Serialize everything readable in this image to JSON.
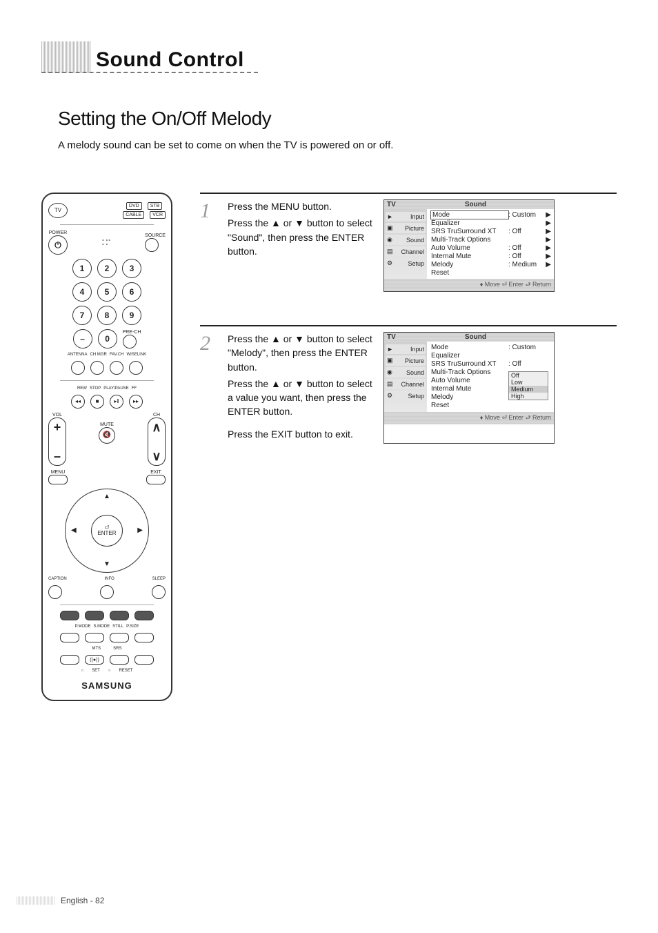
{
  "header": {
    "section_title": "Sound Control"
  },
  "subheading": "Setting the On/Off Melody",
  "intro": "A melody sound can be set to come on when the TV is powered on or off.",
  "remote": {
    "mode_buttons": [
      "DVD",
      "STB",
      "CABLE",
      "VCR"
    ],
    "tv_label": "TV",
    "power_label": "POWER",
    "source_label": "SOURCE",
    "numbers": [
      "1",
      "2",
      "3",
      "4",
      "5",
      "6",
      "7",
      "8",
      "9",
      "0"
    ],
    "prech_label": "PRE-CH",
    "row_labels_a": [
      "ANTENNA",
      "CH MGR",
      "FAV.CH",
      "WISELINK"
    ],
    "row_labels_b": [
      "REW",
      "STOP",
      "PLAY/PAUSE",
      "FF"
    ],
    "vol_label": "VOL",
    "ch_label": "CH",
    "mute_label": "MUTE",
    "menu_label": "MENU",
    "exit_label": "EXIT",
    "enter_label": "ENTER",
    "row_labels_c": [
      "CAPTION",
      "INFO",
      "SLEEP"
    ],
    "row_labels_d": [
      "P.MODE",
      "S.MODE",
      "STILL",
      "P.SIZE"
    ],
    "row_labels_e": [
      "MTS",
      "SRS"
    ],
    "set_label": "SET",
    "reset_label": "RESET",
    "brand": "SAMSUNG"
  },
  "steps": [
    {
      "num": "1",
      "lines": [
        "Press the MENU button.",
        "Press the ▲ or ▼ button to select \"Sound\", then press the ENTER button."
      ]
    },
    {
      "num": "2",
      "lines": [
        "Press the ▲ or ▼ button to select \"Melody\", then press the ENTER button.",
        "Press the ▲ or ▼ button to select a value you want, then press the ENTER button.",
        "Press the EXIT button to exit."
      ]
    }
  ],
  "osd_common": {
    "tv_tag": "TV",
    "title": "Sound",
    "left_tabs": [
      "Input",
      "Picture",
      "Sound",
      "Channel",
      "Setup"
    ],
    "footer": "♦ Move    ⏎ Enter    ⮐ Return"
  },
  "osd1": {
    "rows": [
      {
        "k": "Mode",
        "v": ": Custom",
        "sel": true,
        "ar": "▶"
      },
      {
        "k": "Equalizer",
        "v": "",
        "ar": "▶"
      },
      {
        "k": "SRS TruSurround XT",
        "v": ": Off",
        "ar": "▶"
      },
      {
        "k": "Multi-Track Options",
        "v": "",
        "ar": "▶"
      },
      {
        "k": "Auto Volume",
        "v": ": Off",
        "ar": "▶"
      },
      {
        "k": "Internal Mute",
        "v": ": Off",
        "ar": "▶"
      },
      {
        "k": "Melody",
        "v": ": Medium",
        "ar": "▶"
      },
      {
        "k": "Reset",
        "v": "",
        "ar": ""
      }
    ]
  },
  "osd2": {
    "rows": [
      {
        "k": "Mode",
        "v": ": Custom",
        "ar": ""
      },
      {
        "k": "Equalizer",
        "v": "",
        "ar": ""
      },
      {
        "k": "SRS TruSurround XT",
        "v": ": Off",
        "ar": ""
      },
      {
        "k": "Multi-Track Options",
        "v": "",
        "ar": ""
      },
      {
        "k": "Auto Volume",
        "v": ": Off",
        "ar": ""
      },
      {
        "k": "Internal Mute",
        "v": "",
        "ar": ""
      },
      {
        "k": "Melody",
        "v": "",
        "ar": ""
      },
      {
        "k": "Reset",
        "v": "",
        "ar": ""
      }
    ],
    "popup": [
      "Off",
      "Low",
      "Medium",
      "High"
    ],
    "popup_selected": 2
  },
  "footer_text": "English - 82"
}
